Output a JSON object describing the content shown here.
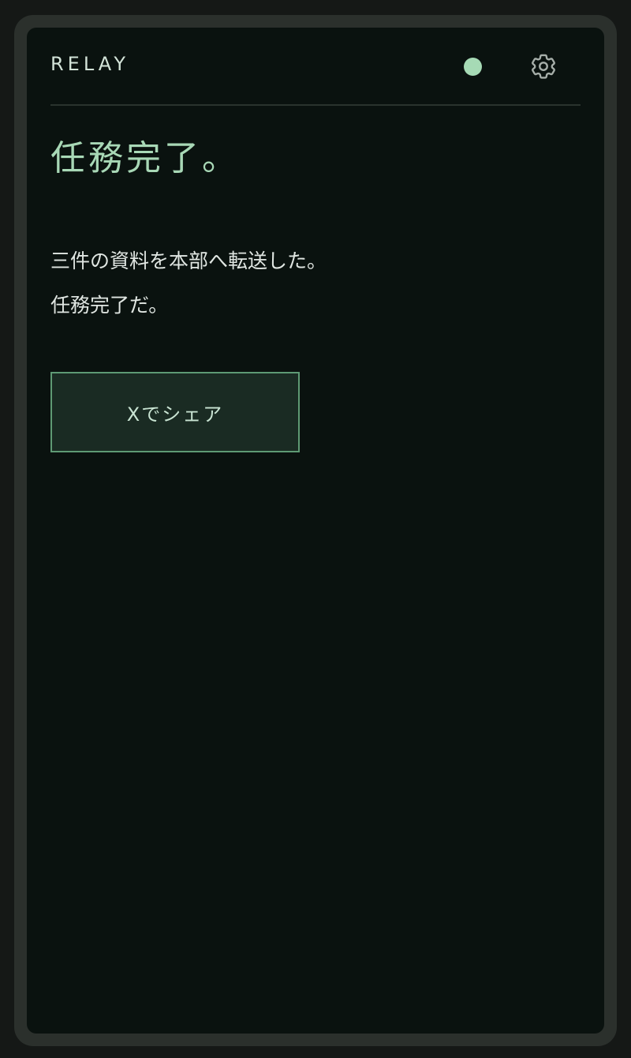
{
  "header": {
    "brand": "RELAY",
    "status_color": "#a6dab5",
    "settings_icon": "gear-icon"
  },
  "main": {
    "title": "任務完了。",
    "message_lines": [
      "三件の資料を本部へ転送した。",
      "任務完了だ。"
    ],
    "share_label": "Xでシェア"
  },
  "colors": {
    "accent": "#a8d8b6",
    "background": "#0a120f",
    "frame": "#2b302c"
  }
}
